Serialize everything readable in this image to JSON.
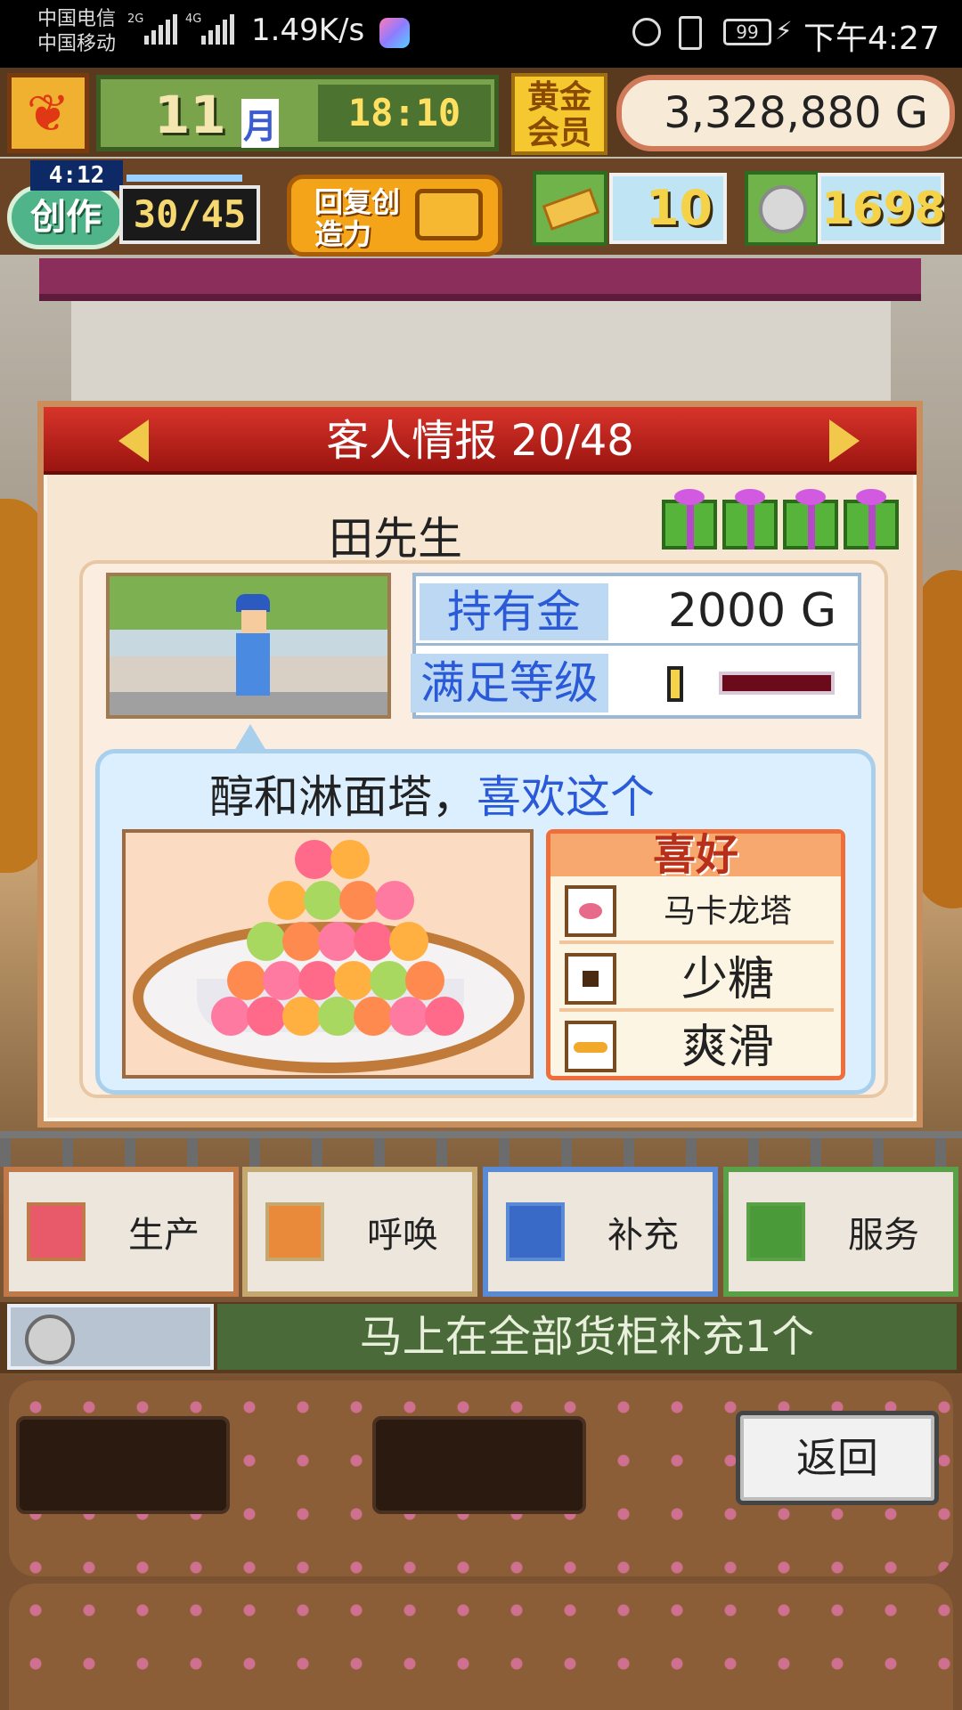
{
  "status_bar": {
    "carrier_1": "中国电信",
    "carrier_2": "中国移动",
    "signal_1_label": "2G",
    "signal_2_label": "4G",
    "net_speed": "1.49K/s",
    "battery": "99",
    "clock": "下午4:27"
  },
  "hud": {
    "month_number": "11",
    "month_label": "月",
    "time": "18:10",
    "gold_member_label": "黄金会员",
    "money": "3,328,880 G",
    "create_timer": "4:12",
    "create_label": "创作",
    "create_value": "30/45",
    "recover_label": "回复创造力",
    "tickets": "10",
    "coins": "1698"
  },
  "dialog": {
    "title": "客人情报 20/48",
    "customer_name": "田先生",
    "stats": {
      "money_label": "持有金",
      "money_value": "2000 G",
      "satisfaction_label": "满足等级",
      "satisfaction_level": 1.0
    },
    "speech": {
      "item": "醇和淋面塔，",
      "reaction": "喜欢这个"
    },
    "preferences": {
      "title": "喜好",
      "items": [
        {
          "label": "马卡龙塔",
          "icon": "macaron-icon"
        },
        {
          "label": "少糖",
          "icon": "square-icon"
        },
        {
          "label": "爽滑",
          "icon": "bar-icon"
        }
      ]
    }
  },
  "actions": [
    {
      "label": "生产",
      "icon": "bread-icon",
      "border": "#c07a4a",
      "icon_bg": "#e85a6a"
    },
    {
      "label": "呼唤",
      "icon": "horn-icon",
      "border": "#c4a870",
      "icon_bg": "#e88a3a"
    },
    {
      "label": "补充",
      "icon": "cake-icon",
      "border": "#5a8ad4",
      "icon_bg": "#3a6ac8"
    },
    {
      "label": "服务",
      "icon": "teacup-icon",
      "border": "#5aa046",
      "icon_bg": "#4a9a3a"
    }
  ],
  "info_bar": {
    "message": "马上在全部货柜补充1个"
  },
  "back_button": "返回"
}
